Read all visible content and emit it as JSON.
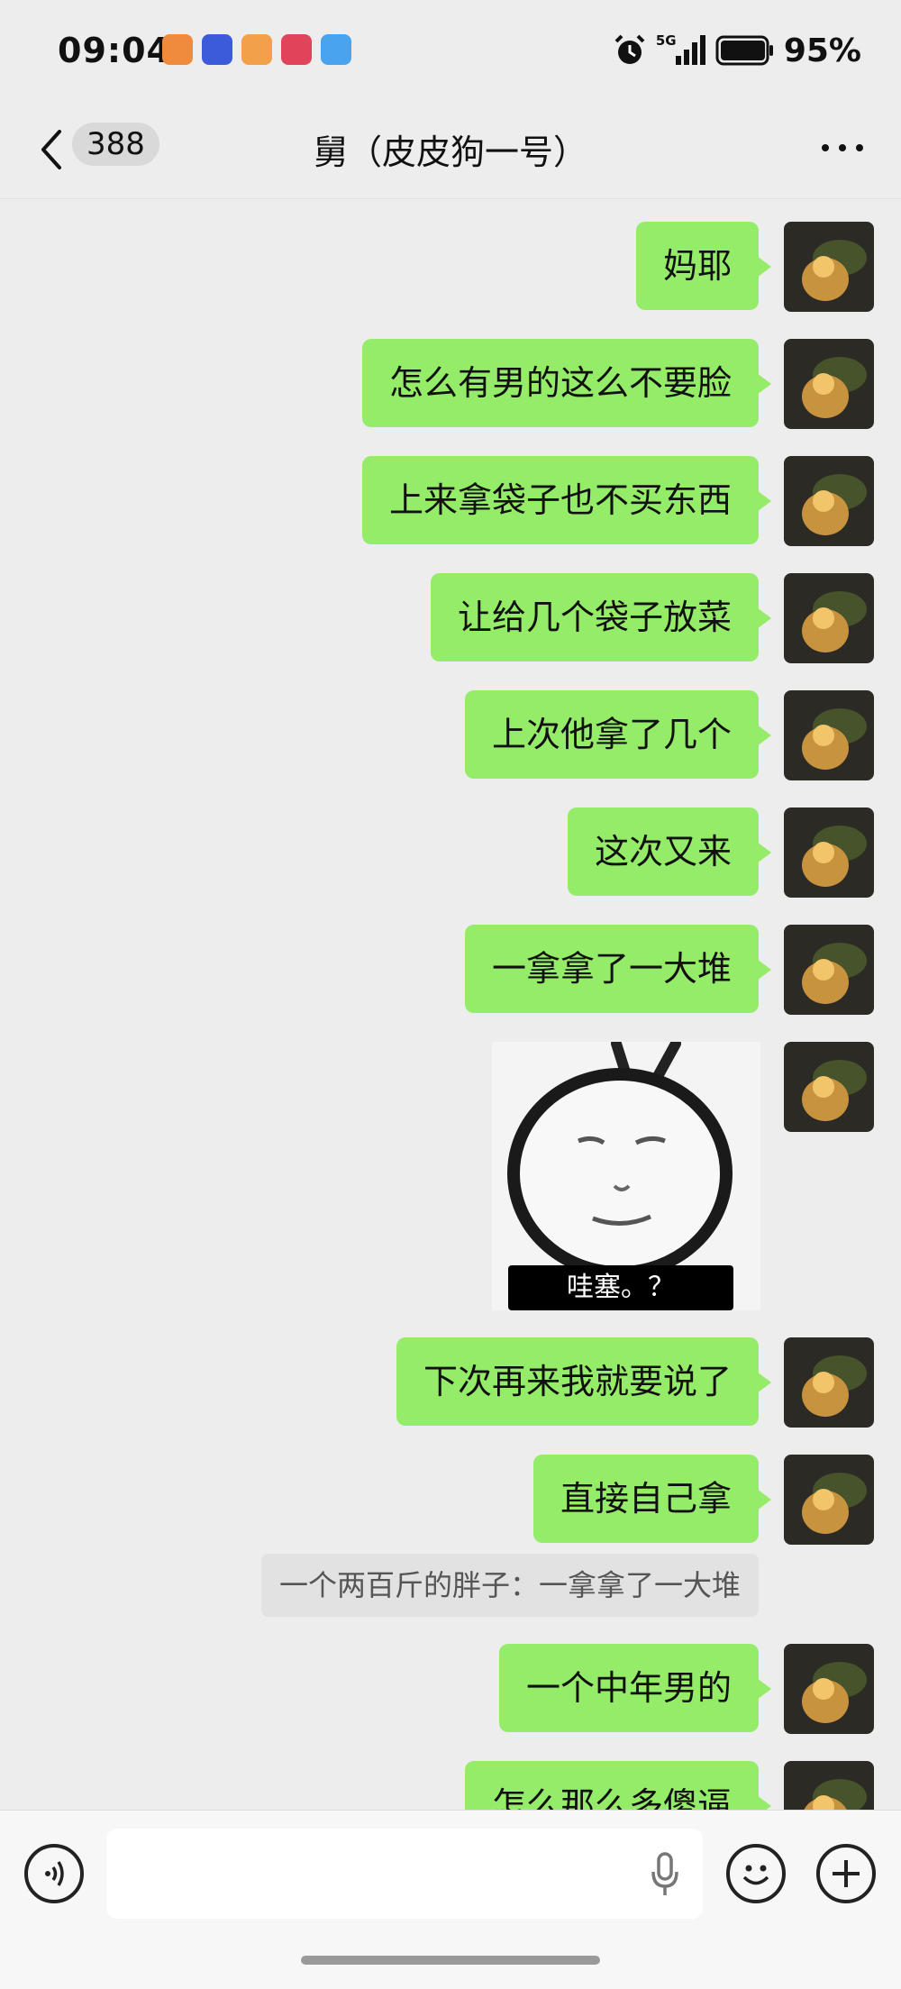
{
  "status_bar": {
    "time": "09:04",
    "network": "5G",
    "battery": "95%",
    "app_icons": [
      "health-app-icon",
      "browser-app-icon",
      "shopping-app-icon",
      "video-app-icon",
      "weather-app-icon"
    ]
  },
  "header": {
    "unread_count": "388",
    "title": "舅（皮皮狗一号）"
  },
  "messages": [
    {
      "type": "text",
      "text": "妈耶"
    },
    {
      "type": "text",
      "text": "怎么有男的这么不要脸"
    },
    {
      "type": "text",
      "text": "上来拿袋子也不买东西"
    },
    {
      "type": "text",
      "text": "让给几个袋子放菜"
    },
    {
      "type": "text",
      "text": "上次他拿了几个"
    },
    {
      "type": "text",
      "text": "这次又来"
    },
    {
      "type": "text",
      "text": "一拿拿了一大堆"
    },
    {
      "type": "sticker",
      "caption": "哇塞。？"
    },
    {
      "type": "text",
      "text": "下次再来我就要说了"
    },
    {
      "type": "text",
      "text": "直接自己拿",
      "quote": "一个两百斤的胖子：一拿拿了一大堆"
    },
    {
      "type": "text",
      "text": "一个中年男的"
    },
    {
      "type": "text",
      "text": "怎么那么多傻逼"
    }
  ],
  "colors": {
    "background": "#ededed",
    "bubble_self": "#95ec69",
    "quote_bg": "#e2e2e2"
  }
}
